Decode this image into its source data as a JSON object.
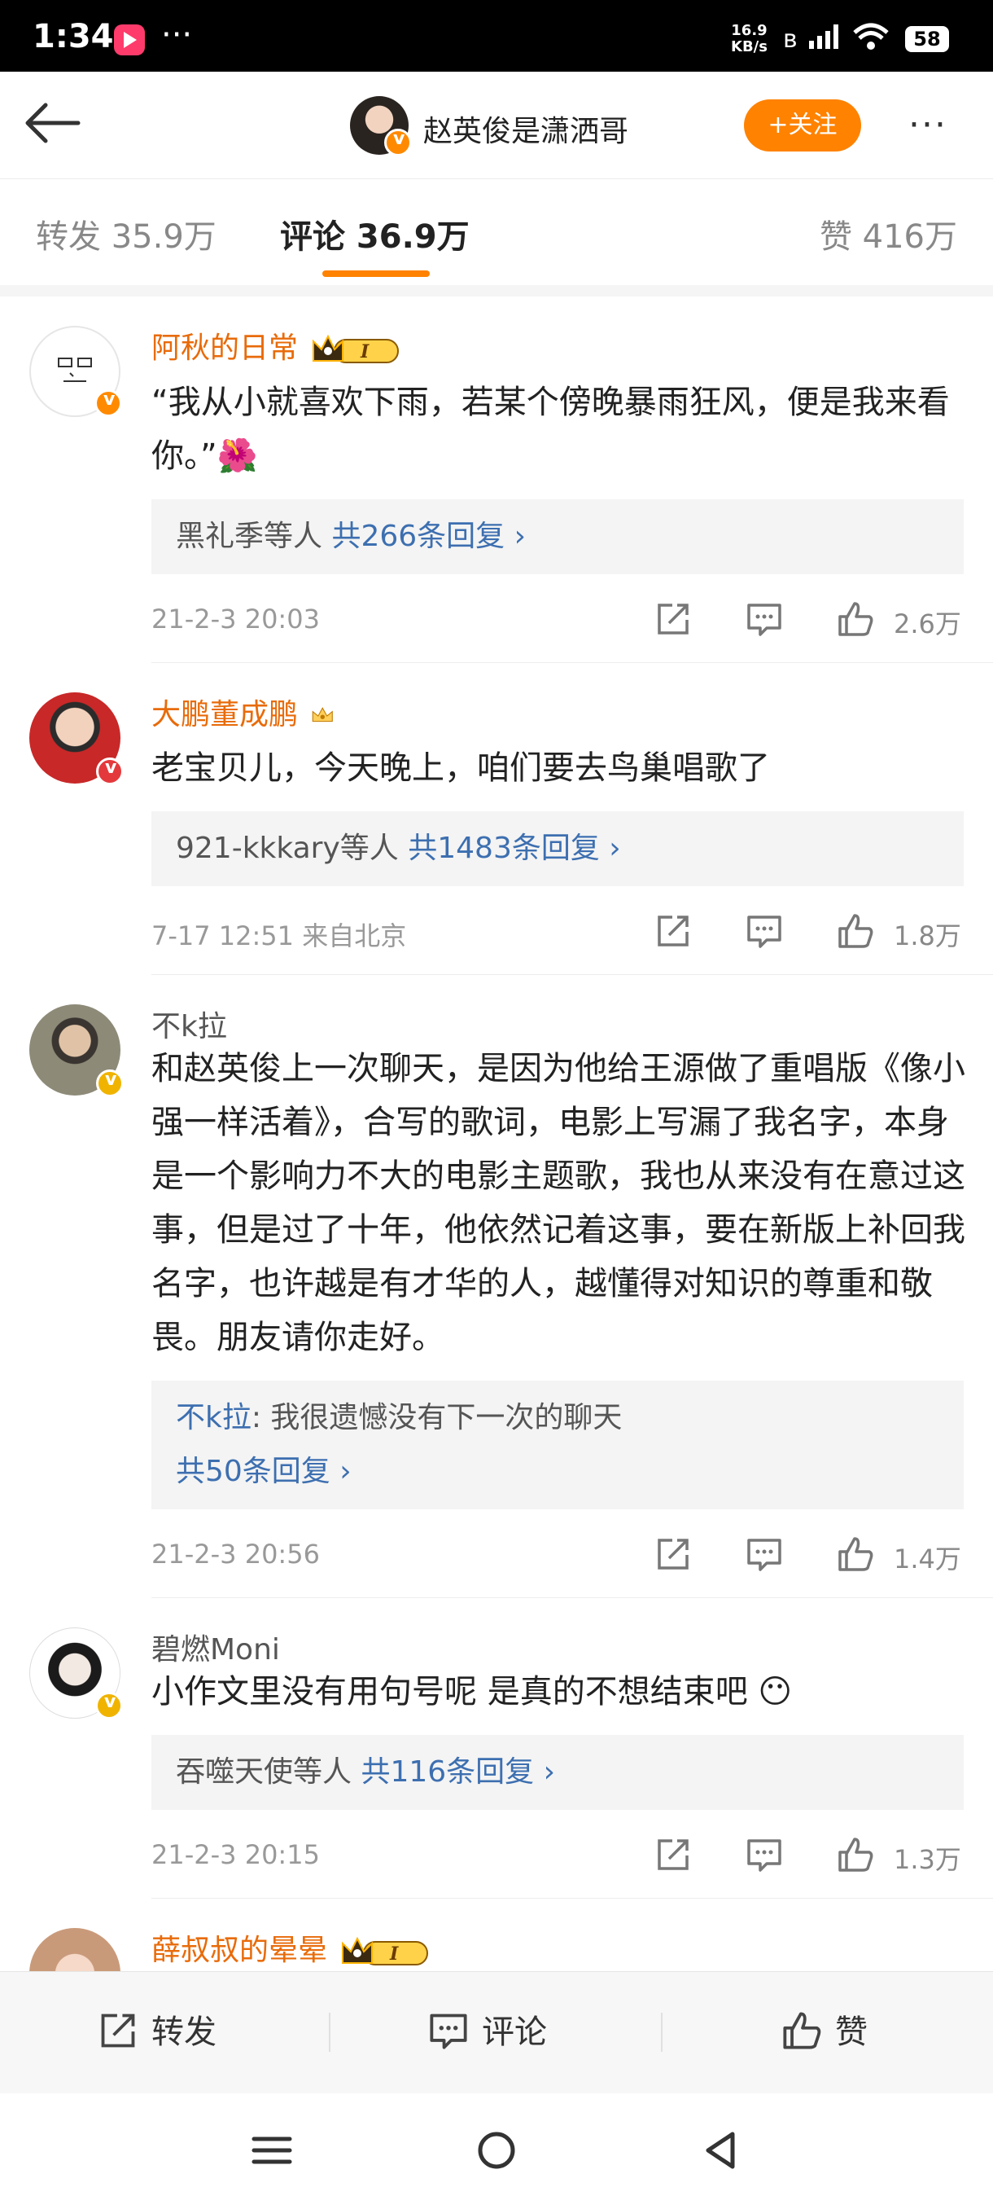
{
  "status_bar": {
    "time": "1:34",
    "more": "···",
    "speed_value": "16.9",
    "speed_unit": "KB/s",
    "battery": "58"
  },
  "header": {
    "title": "赵英俊是潇洒哥",
    "follow_label": "+关注",
    "more_label": "···"
  },
  "tabs": {
    "repost": "转发 35.9万",
    "comment": "评论 36.9万",
    "like": "赞 416万"
  },
  "comments": [
    {
      "username": "阿秋的日常",
      "text": "“我从小就喜欢下雨，若某个傍晚暴雨狂风，便是我来看你。”🌺",
      "reply_users": "黑礼季等人",
      "reply_count": "共266条回复 ›",
      "meta": "21-2-3 20:03",
      "likes": "2.6万"
    },
    {
      "username": "大鹏董成鹏",
      "text": "老宝贝儿，今天晚上，咱们要去鸟巢唱歌了",
      "reply_users": "921-kkkary等人",
      "reply_count": "共1483条回复 ›",
      "meta": "7-17 12:51 来自北京",
      "likes": "1.8万"
    },
    {
      "username": "不k拉",
      "text": "和赵英俊上一次聊天，是因为他给王源做了重唱版《像小强一样活着》，合写的歌词，电影上写漏了我名字，本身是一个影响力不大的电影主题歌，我也从来没有在意过这事，但是过了十年，他依然记着这事，要在新版上补回我名字，也许越是有才华的人，越懂得对知识的尊重和敬畏。朋友请你走好。",
      "reply_preview_name": "不k拉",
      "reply_preview_text": ": 我很遗憾没有下一次的聊天",
      "reply_count": "共50条回复 ›",
      "meta": "21-2-3 20:56",
      "likes": "1.4万"
    },
    {
      "username": "碧燃Moni",
      "text": "小作文里没有用句号呢 是真的不想结束吧 😶",
      "reply_users": "吞噬天使等人",
      "reply_count": "共116条回复 ›",
      "meta": "21-2-3 20:15",
      "likes": "1.3万"
    },
    {
      "username": "薛叔叔的晕晕"
    }
  ],
  "bottom_bar": {
    "repost": "转发",
    "comment": "评论",
    "like": "赞"
  },
  "colors": {
    "accent": "#ff8200",
    "vip_name": "#e86b0a",
    "link": "#3d6fb0"
  }
}
